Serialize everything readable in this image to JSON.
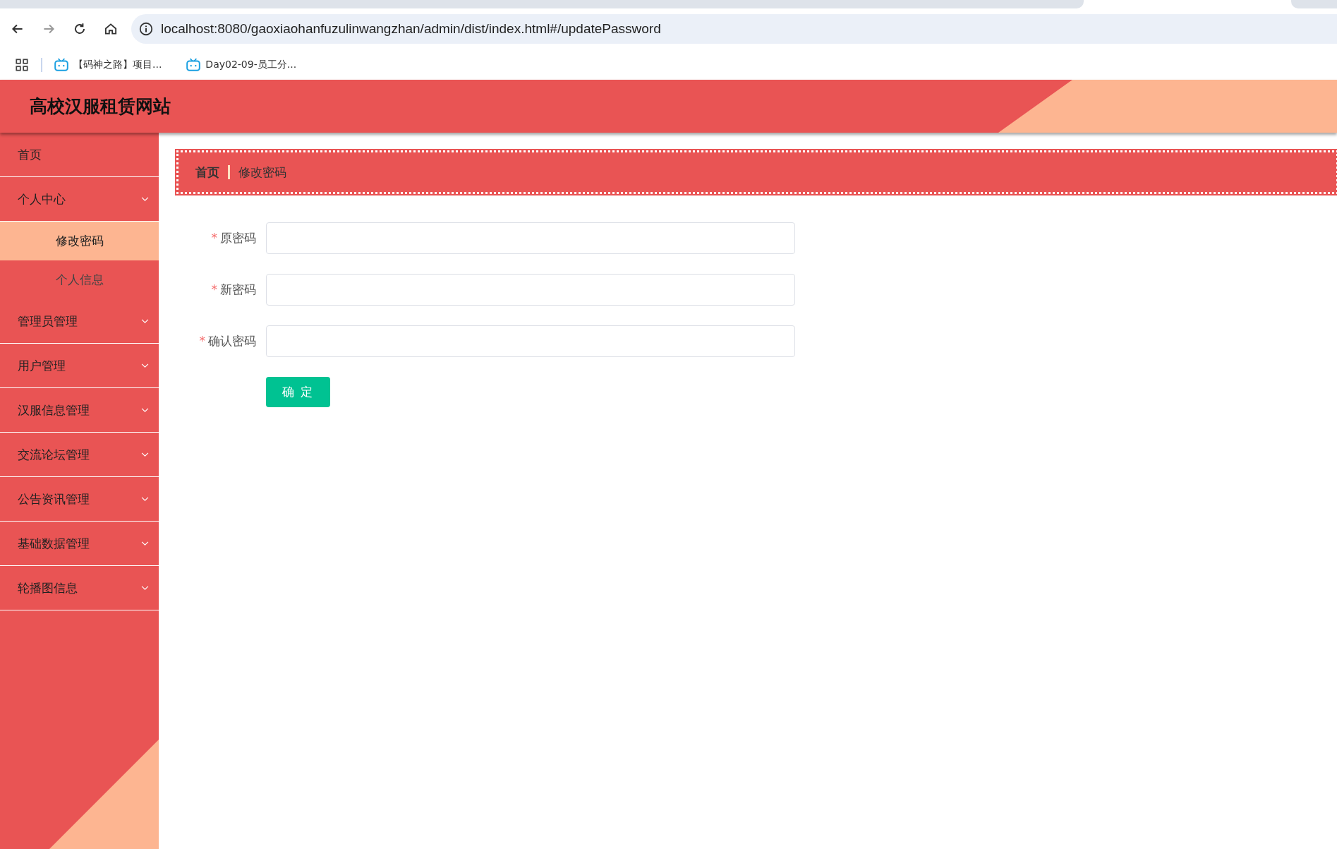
{
  "browser": {
    "url": "localhost:8080/gaoxiaohanfuzulinwangzhan/admin/dist/index.html#/updatePassword",
    "bookmarks": [
      {
        "label": "【码神之路】项目..."
      },
      {
        "label": "Day02-09-员工分..."
      }
    ]
  },
  "header": {
    "title": "高校汉服租赁网站"
  },
  "sidebar": {
    "items": [
      {
        "label": "首页",
        "expanded": false,
        "has_children": false
      },
      {
        "label": "个人中心",
        "expanded": true,
        "has_children": true,
        "children": [
          {
            "label": "修改密码",
            "selected": true
          },
          {
            "label": "个人信息",
            "selected": false
          }
        ]
      },
      {
        "label": "管理员管理",
        "expanded": false,
        "has_children": true
      },
      {
        "label": "用户管理",
        "expanded": false,
        "has_children": true
      },
      {
        "label": "汉服信息管理",
        "expanded": false,
        "has_children": true
      },
      {
        "label": "交流论坛管理",
        "expanded": false,
        "has_children": true
      },
      {
        "label": "公告资讯管理",
        "expanded": false,
        "has_children": true
      },
      {
        "label": "基础数据管理",
        "expanded": false,
        "has_children": true
      },
      {
        "label": "轮播图信息",
        "expanded": false,
        "has_children": true
      }
    ]
  },
  "breadcrumb": [
    {
      "label": "首页"
    },
    {
      "label": "修改密码"
    }
  ],
  "form": {
    "fields": [
      {
        "label": "原密码",
        "required_mark": "*"
      },
      {
        "label": "新密码",
        "required_mark": "*"
      },
      {
        "label": "确认密码",
        "required_mark": "*"
      }
    ],
    "submit": "确 定"
  }
}
